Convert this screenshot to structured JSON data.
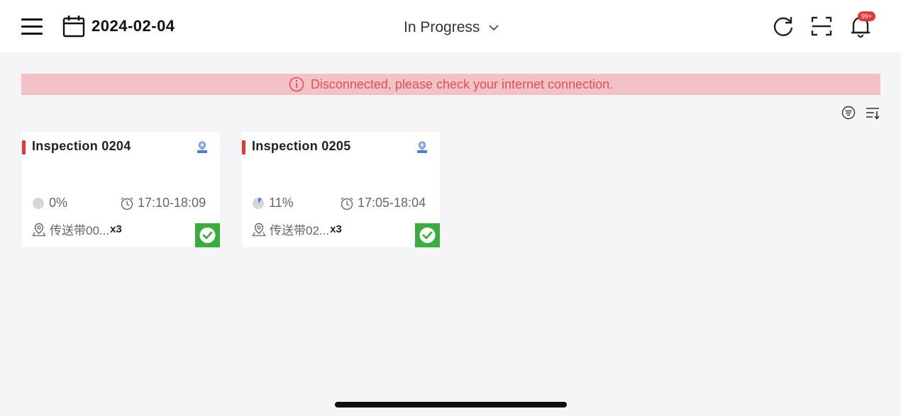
{
  "header": {
    "date": "2024-02-04",
    "status_filter": "In Progress",
    "notification_badge": "99+"
  },
  "alert": {
    "message": "Disconnected, please check your internet connection.",
    "color": "#e0505a",
    "background": "#f3c2c7"
  },
  "tasks": [
    {
      "title": "Inspection 0204",
      "progress": "0%",
      "progress_value": 0,
      "time_range": "17:10-18:09",
      "location": "传送带00...",
      "multiplier": "x3",
      "completed": true
    },
    {
      "title": "Inspection 0205",
      "progress": "11%",
      "progress_value": 0.11,
      "time_range": "17:05-18:04",
      "location": "传送带02...",
      "multiplier": "x3",
      "completed": true
    }
  ],
  "colors": {
    "priority": "#e53935",
    "done": "#3aad3f",
    "accent": "#4a7fd4"
  }
}
